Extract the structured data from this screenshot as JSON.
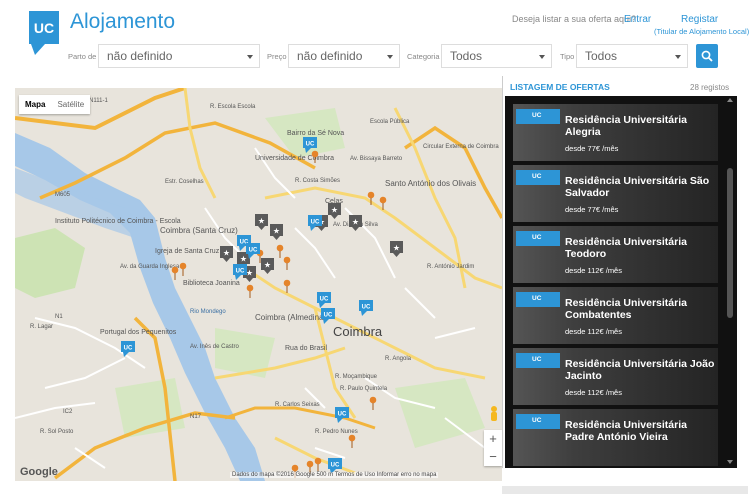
{
  "app": {
    "title": "Alojamento",
    "logo_text": "UC"
  },
  "header": {
    "list_question": "Deseja listar a sua oferta aqui?",
    "login_label": "Entrar",
    "register_label": "Registar",
    "register_sub": "(Titular de Alojamento Local)"
  },
  "filters": [
    {
      "label": "Parto de",
      "value": "não definido"
    },
    {
      "label": "Preço",
      "value": "não definido"
    },
    {
      "label": "Categoria",
      "value": "Todos"
    },
    {
      "label": "Tipo",
      "value": "Todos"
    }
  ],
  "map": {
    "type_map": "Mapa",
    "type_satellite": "Satélite",
    "zoom_in": "+",
    "zoom_out": "−",
    "google": "Google",
    "attribution": "Dados do mapa ©2016 Google   500 m         Termos de Uso   Informar erro no mapa",
    "labels": [
      "Coimbra",
      "Universidade de Coimbra",
      "Santo António dos Olivais",
      "Portugal dos Pequenitos",
      "Igreja de Santa Cruz",
      "Biblioteca Joanina",
      "Coimbra (Santa Cruz)",
      "Instituto Politécnico de Coimbra - Escola",
      "Bairro da Sé Nova",
      "Celas",
      "Coimbra (Almedina)",
      "Rua do Brasil",
      "R. Moçambique",
      "R. Paulo Quintela",
      "R. Carlos Seixas",
      "R. Angola",
      "R. Costa Simões",
      "Av. Bissaya Barreto",
      "Circular Externa de Coimbra",
      "Av. Dias da Silva",
      "R. Pedro Nunes",
      "Av. da Guarda Inglesa",
      "Av. Inês de Castro",
      "Rio Mondego",
      "R. Lagar",
      "R. Sol Posto",
      "M605",
      "N17",
      "N1",
      "IC2",
      "EN111-1",
      "Estr. Coselhas",
      "R. António Jardim",
      "R. Escola Escola",
      "Escola Pública"
    ]
  },
  "listing": {
    "title": "LISTAGEM DE OFERTAS",
    "count": "28 registos",
    "offers": [
      {
        "badge": "UC",
        "name": "Residência Universitária Alegria",
        "price": "desde 77€ /mês"
      },
      {
        "badge": "UC",
        "name": "Residência Universitária São Salvador",
        "price": "desde 77€ /mês"
      },
      {
        "badge": "UC",
        "name": "Residência Universitária Teodoro",
        "price": "desde 112€ /mês"
      },
      {
        "badge": "UC",
        "name": "Residência Universitária Combatentes",
        "price": "desde 112€ /mês"
      },
      {
        "badge": "UC",
        "name": "Residência Universitária João Jacinto",
        "price": "desde 112€ /mês"
      },
      {
        "badge": "UC",
        "name": "Residência Universitária Padre António Vieira",
        "price": ""
      }
    ]
  },
  "colors": {
    "brand": "#2d95d6",
    "pin_orange": "#e5842a",
    "pin_gray": "#5a5a5a"
  }
}
